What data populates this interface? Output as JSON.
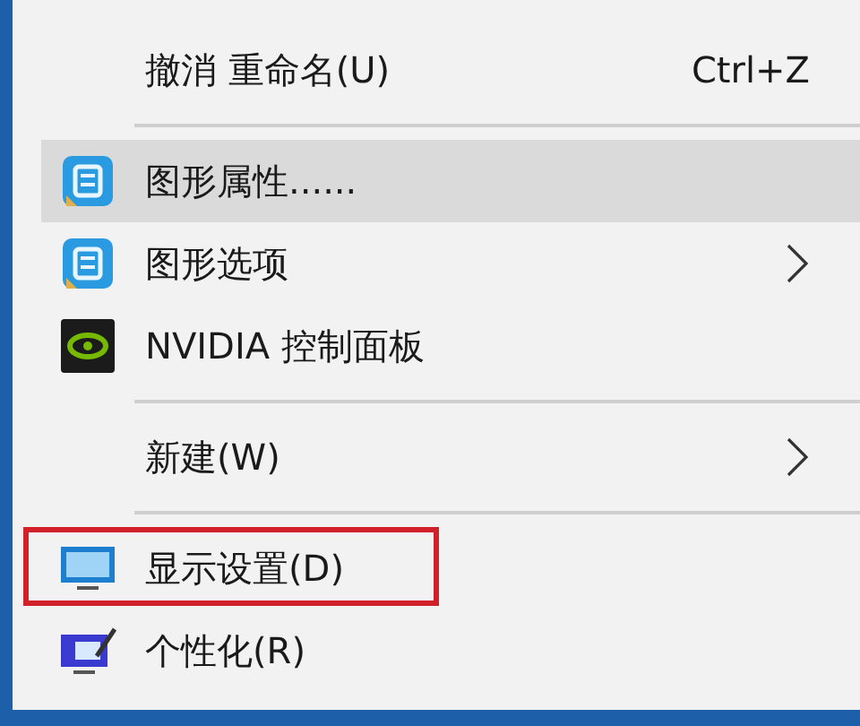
{
  "menu": {
    "items": [
      {
        "kind": "plain",
        "label": "撤消 重命名(U)",
        "shortcut": "Ctrl+Z",
        "submenu": false,
        "selected": false,
        "outlined": false
      },
      {
        "kind": "separator"
      },
      {
        "kind": "graphics",
        "label": "图形属性......",
        "submenu": false,
        "selected": true,
        "outlined": false
      },
      {
        "kind": "graphics",
        "label": "图形选项",
        "submenu": true,
        "selected": false,
        "outlined": false
      },
      {
        "kind": "nvidia",
        "label": "NVIDIA 控制面板",
        "submenu": false,
        "selected": false,
        "outlined": false
      },
      {
        "kind": "separator"
      },
      {
        "kind": "plain",
        "label": "新建(W)",
        "submenu": true,
        "selected": false,
        "outlined": false
      },
      {
        "kind": "separator"
      },
      {
        "kind": "display",
        "label": "显示设置(D)",
        "submenu": false,
        "selected": false,
        "outlined": true
      },
      {
        "kind": "personalize",
        "label": "个性化(R)",
        "submenu": false,
        "selected": false,
        "outlined": false
      }
    ]
  }
}
